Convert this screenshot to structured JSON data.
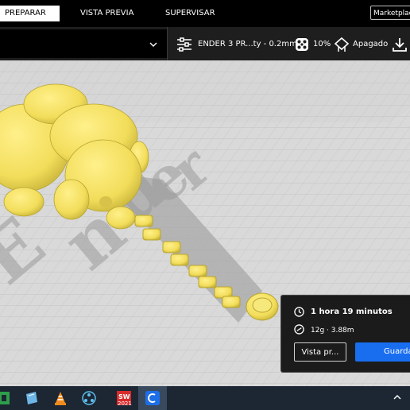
{
  "header": {
    "tabs": [
      {
        "label": "PREPARAR",
        "active": true
      },
      {
        "label": "VISTA PREVIA",
        "active": false
      },
      {
        "label": "SUPERVISAR",
        "active": false
      }
    ],
    "marketplace_label": "Marketplace"
  },
  "toolbar": {
    "printer_profile": "ENDER 3 PR...ty - 0.2mm",
    "infill": "10%",
    "support": "Apagado",
    "icons": [
      "settings-sliders-icon",
      "infill-icon",
      "support-icon",
      "download-icon",
      "chevron-down-icon"
    ]
  },
  "viewport": {
    "watermark_text": "Ender",
    "model_color": "#f7e36b",
    "bed_color": "#d6d6d6"
  },
  "print_info": {
    "time": "1 hora 19 minutos",
    "material": "12g · 3.88m",
    "preview_button": "Vista pr...",
    "save_button": "Guardar"
  },
  "taskbar": {
    "apps": [
      "app-green-icon",
      "app-notepad-icon",
      "vlc-icon",
      "app-network-icon",
      "solidworks-2021-icon",
      "cura-icon"
    ],
    "solidworks_label": "2021",
    "active_app": "cura-icon"
  },
  "colors": {
    "accent": "#196ef0",
    "topbar": "#000000",
    "panel": "#1b1b1b"
  }
}
